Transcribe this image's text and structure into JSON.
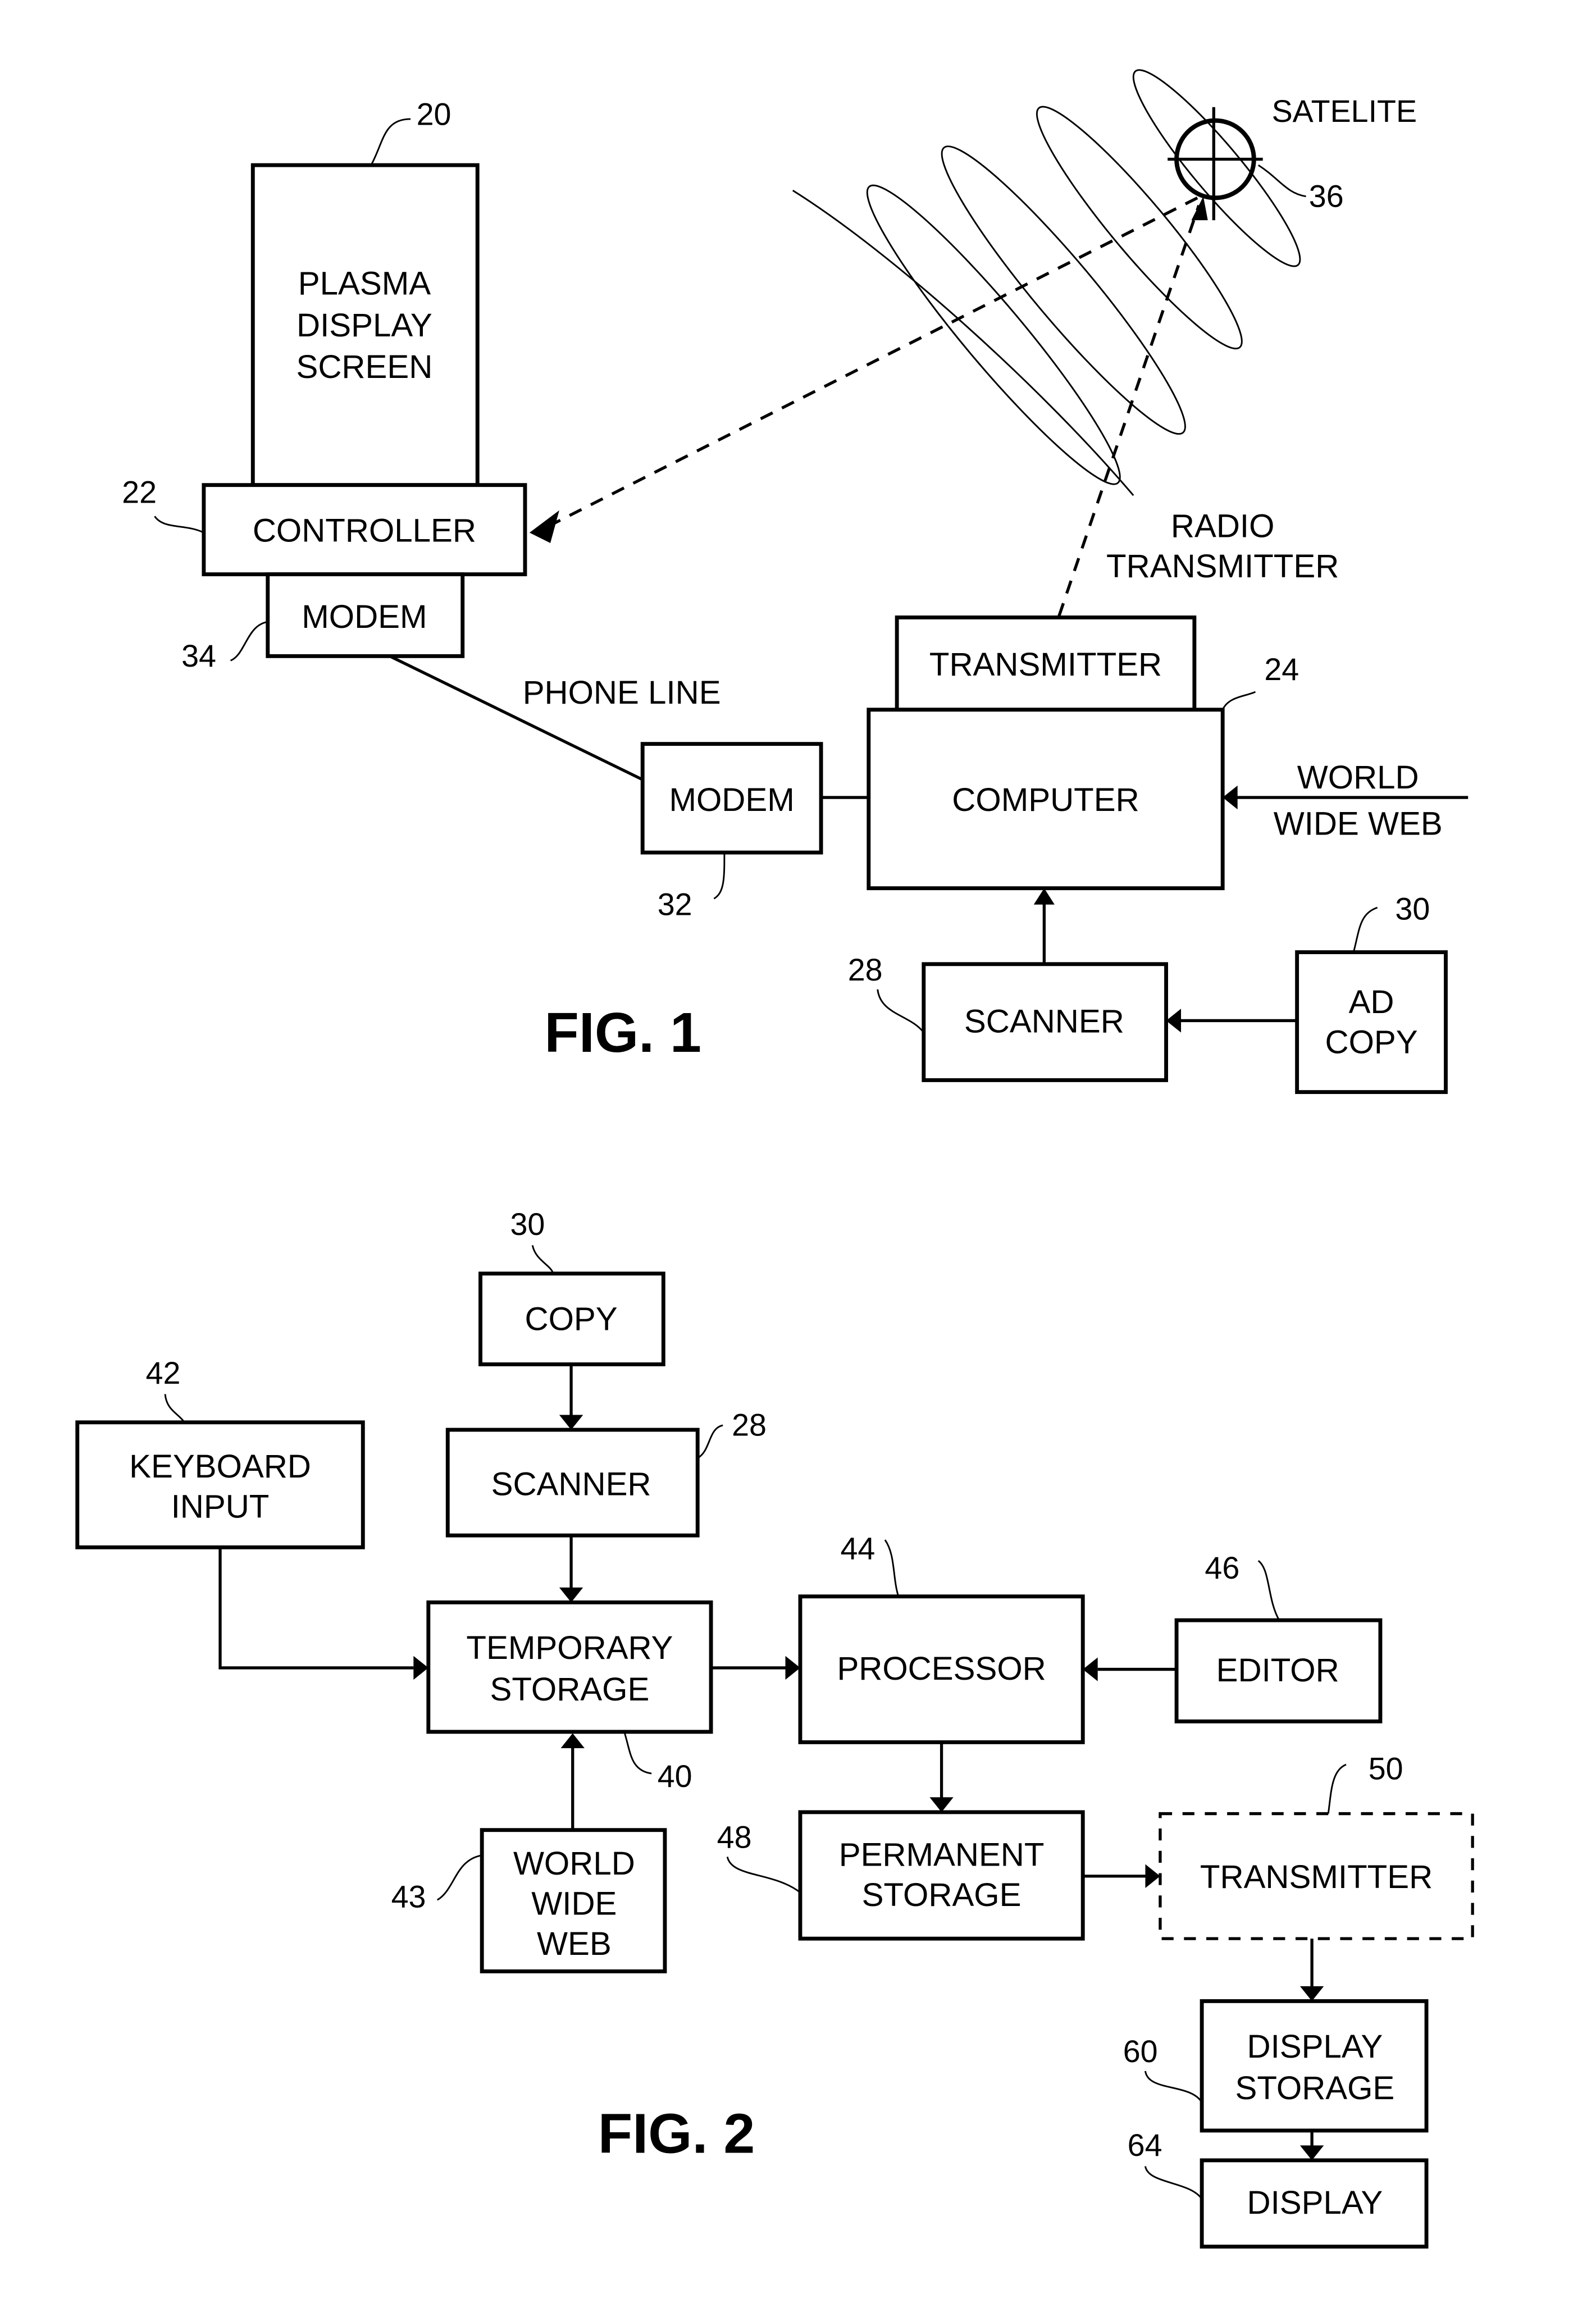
{
  "fig1": {
    "title": "FIG. 1",
    "plasma_screen": {
      "lines": [
        "PLASMA",
        "DISPLAY",
        "SCREEN"
      ],
      "ref": "20"
    },
    "controller": {
      "label": "CONTROLLER",
      "ref": "22"
    },
    "modem_display": {
      "label": "MODEM",
      "ref": "34"
    },
    "phone_line": "PHONE LINE",
    "modem_computer": {
      "label": "MODEM",
      "ref": "32"
    },
    "transmitter": {
      "label": "TRANSMITTER"
    },
    "computer": {
      "label": "COMPUTER",
      "ref": "24"
    },
    "world_wide_web": {
      "lines": [
        "WORLD",
        "WIDE WEB"
      ]
    },
    "scanner": {
      "label": "SCANNER",
      "ref": "28"
    },
    "ad_copy": {
      "lines": [
        "AD",
        "COPY"
      ],
      "ref": "30"
    },
    "satellite": {
      "label": "SATELITE",
      "ref": "36"
    },
    "radio_transmitter": {
      "lines": [
        "RADIO",
        "TRANSMITTER"
      ]
    }
  },
  "fig2": {
    "title": "FIG. 2",
    "copy": {
      "label": "COPY",
      "ref": "30"
    },
    "scanner": {
      "label": "SCANNER",
      "ref": "28"
    },
    "keyboard_input": {
      "lines": [
        "KEYBOARD",
        "INPUT"
      ],
      "ref": "42"
    },
    "temporary_storage": {
      "lines": [
        "TEMPORARY",
        "STORAGE"
      ],
      "ref": "40"
    },
    "world_wide_web": {
      "lines": [
        "WORLD",
        "WIDE",
        "WEB"
      ],
      "ref": "43"
    },
    "processor": {
      "label": "PROCESSOR",
      "ref": "44"
    },
    "editor": {
      "label": "EDITOR",
      "ref": "46"
    },
    "permanent_storage": {
      "lines": [
        "PERMANENT",
        "STORAGE"
      ],
      "ref": "48"
    },
    "transmitter": {
      "label": "TRANSMITTER",
      "ref": "50"
    },
    "display_storage": {
      "lines": [
        "DISPLAY",
        "STORAGE"
      ],
      "ref": "60"
    },
    "display": {
      "label": "DISPLAY",
      "ref": "64"
    }
  }
}
